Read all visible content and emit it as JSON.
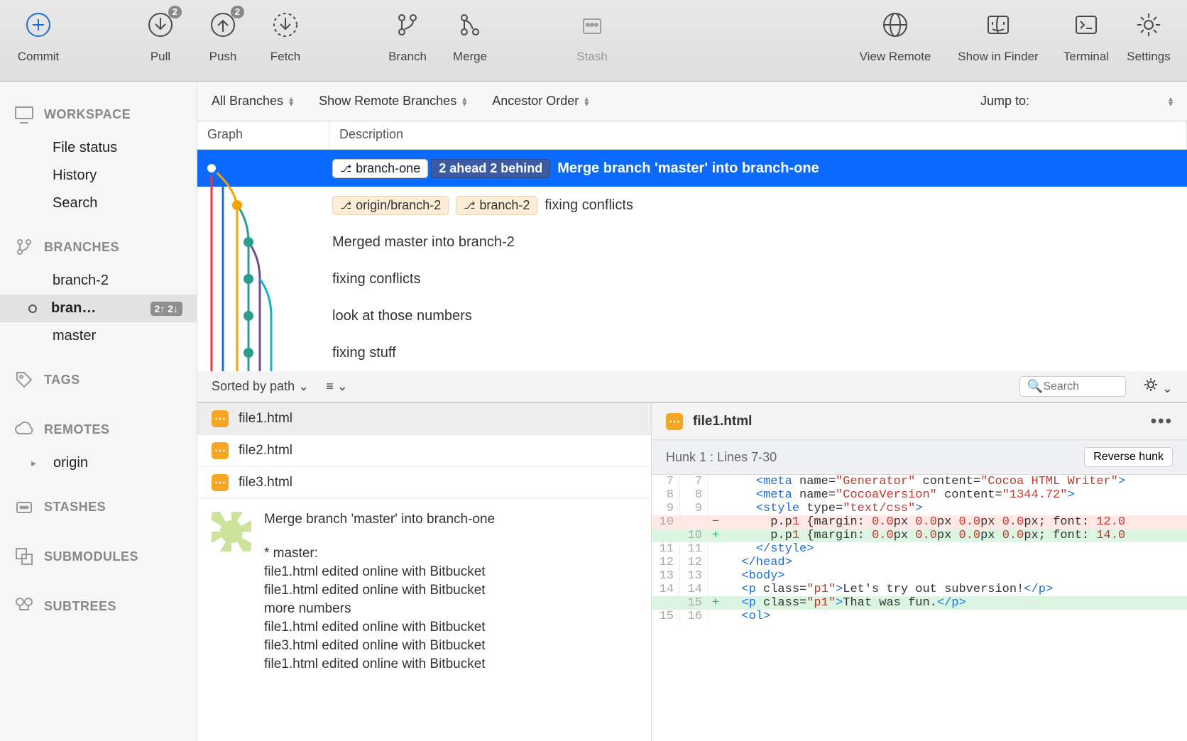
{
  "toolbar": {
    "commit": "Commit",
    "pull": "Pull",
    "pull_badge": "2",
    "push": "Push",
    "push_badge": "2",
    "fetch": "Fetch",
    "branch": "Branch",
    "merge": "Merge",
    "stash": "Stash",
    "view_remote": "View Remote",
    "show_finder": "Show in Finder",
    "terminal": "Terminal",
    "settings": "Settings"
  },
  "filters": {
    "branches": "All Branches",
    "remote": "Show Remote Branches",
    "order": "Ancestor Order",
    "jump": "Jump to:"
  },
  "sidebar": {
    "workspace": {
      "title": "WORKSPACE",
      "file_status": "File status",
      "history": "History",
      "search": "Search"
    },
    "branches": {
      "title": "BRANCHES",
      "items": [
        "branch-2",
        "bran…",
        "master"
      ],
      "active_index": 1,
      "active_badge": "2↑ 2↓"
    },
    "tags": "TAGS",
    "remotes": {
      "title": "REMOTES",
      "origin": "origin"
    },
    "stashes": "STASHES",
    "submodules": "SUBMODULES",
    "subtrees": "SUBTREES"
  },
  "table": {
    "graph": "Graph",
    "description": "Description"
  },
  "commits": [
    {
      "tags": [
        {
          "name": "branch-one",
          "style": "white"
        }
      ],
      "ahead_behind": "2 ahead 2 behind",
      "msg": "Merge branch 'master' into branch-one",
      "selected": true
    },
    {
      "tags": [
        {
          "name": "origin/branch-2",
          "style": "orange"
        },
        {
          "name": "branch-2",
          "style": "orange"
        }
      ],
      "msg": "fixing conflicts"
    },
    {
      "msg": "Merged master into branch-2"
    },
    {
      "msg": "fixing conflicts"
    },
    {
      "msg": "look at those numbers"
    },
    {
      "msg": "fixing stuff"
    }
  ],
  "bottom_toolbar": {
    "sort": "Sorted by path",
    "search_placeholder": "Search"
  },
  "files": [
    {
      "name": "file1.html",
      "selected": true
    },
    {
      "name": "file2.html"
    },
    {
      "name": "file3.html"
    }
  ],
  "commit_message": {
    "title": "Merge branch 'master' into branch-one",
    "lines": [
      "* master:",
      "file1.html edited online with Bitbucket",
      "file1.html edited online with Bitbucket",
      "more numbers",
      "file1.html edited online with Bitbucket",
      "file3.html edited online with Bitbucket",
      "file1.html edited online with Bitbucket"
    ]
  },
  "diff": {
    "file": "file1.html",
    "hunk": "Hunk 1 : Lines 7-30",
    "reverse": "Reverse hunk",
    "rows": [
      {
        "a": "7",
        "b": "7",
        "t": "ctx",
        "code": "    <meta name=\"Generator\" content=\"Cocoa HTML Writer\">"
      },
      {
        "a": "8",
        "b": "8",
        "t": "ctx",
        "code": "    <meta name=\"CocoaVersion\" content=\"1344.72\">"
      },
      {
        "a": "9",
        "b": "9",
        "t": "ctx",
        "code": "    <style type=\"text/css\">"
      },
      {
        "a": "10",
        "b": "",
        "t": "del",
        "code": "      p.p1 {margin: 0.0px 0.0px 0.0px 0.0px; font: 12.0"
      },
      {
        "a": "",
        "b": "10",
        "t": "add",
        "code": "      p.p1 {margin: 0.0px 0.0px 0.0px 0.0px; font: 14.0"
      },
      {
        "a": "11",
        "b": "11",
        "t": "ctx",
        "code": "    </style>"
      },
      {
        "a": "12",
        "b": "12",
        "t": "ctx",
        "code": "  </head>"
      },
      {
        "a": "13",
        "b": "13",
        "t": "ctx",
        "code": "  <body>"
      },
      {
        "a": "14",
        "b": "14",
        "t": "ctx",
        "code": "  <p class=\"p1\">Let's try out subversion!</p>"
      },
      {
        "a": "",
        "b": "15",
        "t": "add",
        "code": "  <p class=\"p1\">That was fun.</p>"
      },
      {
        "a": "15",
        "b": "16",
        "t": "ctx",
        "code": "  <ol>"
      }
    ]
  }
}
